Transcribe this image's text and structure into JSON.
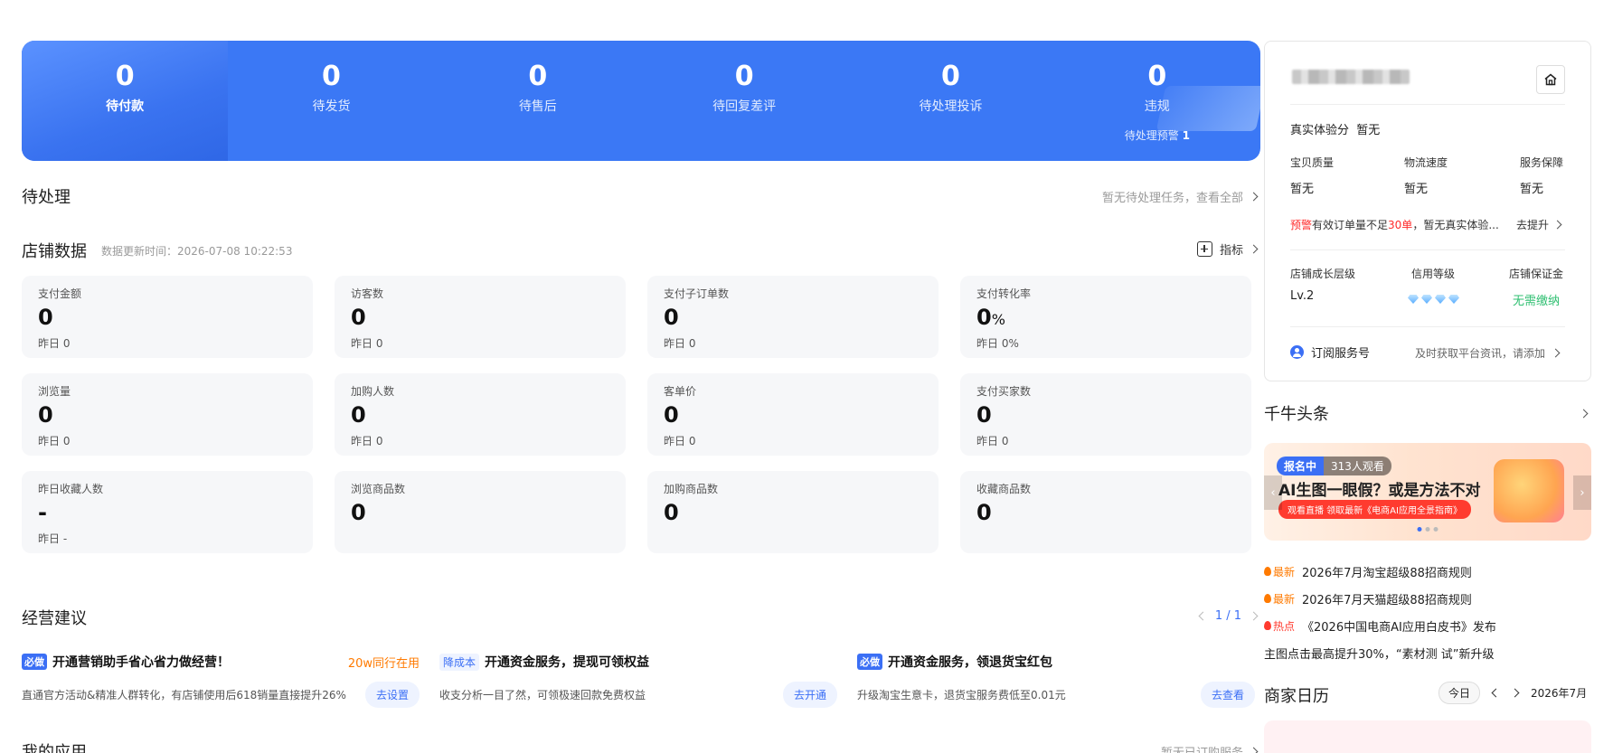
{
  "status_bar": [
    {
      "count": "0",
      "label": "待付款"
    },
    {
      "count": "0",
      "label": "待发货"
    },
    {
      "count": "0",
      "label": "待售后"
    },
    {
      "count": "0",
      "label": "待回复差评"
    },
    {
      "count": "0",
      "label": "待处理投诉"
    },
    {
      "count": "0",
      "label": "违规",
      "sub_label": "待处理预警",
      "sub_count": "1"
    }
  ],
  "pending": {
    "title": "待处理",
    "right_text": "暂无待处理任务，查看全部"
  },
  "shop_data": {
    "title": "店铺数据",
    "update_time": "数据更新时间：2026-07-08 10:22:53",
    "indicator_label": "指标",
    "metrics": [
      {
        "label": "支付金额",
        "value": "0",
        "unit": "",
        "yesterday": "昨日 0"
      },
      {
        "label": "访客数",
        "value": "0",
        "unit": "",
        "yesterday": "昨日 0"
      },
      {
        "label": "支付子订单数",
        "value": "0",
        "unit": "",
        "yesterday": "昨日 0"
      },
      {
        "label": "支付转化率",
        "value": "0",
        "unit": "%",
        "yesterday": "昨日 0%"
      },
      {
        "label": "浏览量",
        "value": "0",
        "unit": "",
        "yesterday": "昨日 0"
      },
      {
        "label": "加购人数",
        "value": "0",
        "unit": "",
        "yesterday": "昨日 0"
      },
      {
        "label": "客单价",
        "value": "0",
        "unit": "",
        "yesterday": "昨日 0"
      },
      {
        "label": "支付买家数",
        "value": "0",
        "unit": "",
        "yesterday": "昨日 0"
      },
      {
        "label": "昨日收藏人数",
        "value": "-",
        "unit": "",
        "yesterday": "昨日 -"
      },
      {
        "label": "浏览商品数",
        "value": "0",
        "unit": "",
        "yesterday": ""
      },
      {
        "label": "加购商品数",
        "value": "0",
        "unit": "",
        "yesterday": ""
      },
      {
        "label": "收藏商品数",
        "value": "0",
        "unit": "",
        "yesterday": ""
      }
    ]
  },
  "suggestions": {
    "title": "经营建议",
    "pager": "1 / 1",
    "items": [
      {
        "tag": "必做",
        "title": "开通营销助手省心省力做经营！",
        "right": "20w同行在用",
        "desc": "直通官方活动&精准人群转化，有店铺使用后618销量直接提升26%",
        "button": "去设置"
      },
      {
        "tag": "降成本",
        "title": "开通资金服务，提现可领权益",
        "right": "",
        "desc": "收支分析一目了然，可领极速回款免费权益",
        "button": "去开通"
      },
      {
        "tag": "必做",
        "title": "开通资金服务，领退货宝红包",
        "right": "",
        "desc": "升级淘宝生意卡，退货宝服务费低至0.01元",
        "button": "去查看"
      }
    ]
  },
  "my_apps": {
    "title": "我的应用",
    "right_text": "暂无已订购服务"
  },
  "shop_panel": {
    "experience_label": "真实体验分",
    "experience_value": "暂无",
    "sub_scores": [
      {
        "label": "宝贝质量",
        "value": "暂无"
      },
      {
        "label": "物流速度",
        "value": "暂无"
      },
      {
        "label": "服务保障",
        "value": "暂无"
      }
    ],
    "warning_tag": "预警",
    "warning_text_pre": "有效订单量不足",
    "warning_highlight": "30单",
    "warning_text_post": "，暂无真实体验...",
    "warning_action": "去提升",
    "growth_label": "店铺成长层级",
    "growth_value": "Lv.2",
    "credit_label": "信用等级",
    "credit_diamonds": 4,
    "deposit_label": "店铺保证金",
    "deposit_value": "无需缴纳",
    "subscribe_label": "订阅服务号",
    "subscribe_hint": "及时获取平台资讯，请添加"
  },
  "headlines": {
    "title": "千牛头条",
    "banner": {
      "status": "报名中",
      "viewers": "313人观看",
      "title": "AI生图一眼假？或是方法不对",
      "sub": "观看直播 领取最新《电商AI应用全景指南》"
    },
    "news": [
      {
        "tag": "最新",
        "tag_type": "new",
        "text": "2026年7月淘宝超级88招商规则"
      },
      {
        "tag": "最新",
        "tag_type": "new",
        "text": "2026年7月天猫超级88招商规则"
      },
      {
        "tag": "热点",
        "tag_type": "hot",
        "text": "《2026中国电商AI应用白皮书》发布"
      },
      {
        "tag": "",
        "tag_type": "",
        "text": "主图点击最高提升30%，“素材测 试”新升级"
      }
    ]
  },
  "calendar": {
    "title": "商家日历",
    "today_label": "今日",
    "month": "2026年7月"
  },
  "colors": {
    "primary": "#3b78f5",
    "accent_blue": "#3b6ff5",
    "warning_red": "#ff2b2b",
    "orange": "#ff7a00",
    "green": "#2fbf71"
  }
}
